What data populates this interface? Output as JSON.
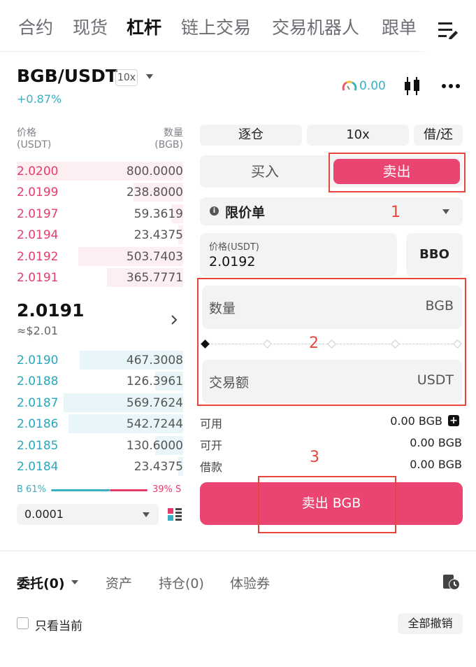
{
  "top_tabs": [
    {
      "label": "合约"
    },
    {
      "label": "现货"
    },
    {
      "label": "杠杆"
    },
    {
      "label": "链上交易"
    },
    {
      "label": "交易机器人"
    },
    {
      "label": "跟单"
    }
  ],
  "active_tab": "杠杆",
  "header": {
    "pair": "BGB/USDT",
    "leverage_badge": "10x",
    "change": "+0.87%",
    "gauge_value": "0.00"
  },
  "orderbook": {
    "price_label": "价格",
    "price_unit": "(USDT)",
    "qty_label": "数量",
    "qty_unit": "(BGB)",
    "asks": [
      {
        "price": "2.0200",
        "qty": "800.0000",
        "depth": 1.0
      },
      {
        "price": "2.0199",
        "qty": "238.8000",
        "depth": 0.3
      },
      {
        "price": "2.0197",
        "qty": "59.3619",
        "depth": 0.07
      },
      {
        "price": "2.0194",
        "qty": "23.4375",
        "depth": 0.03
      },
      {
        "price": "2.0192",
        "qty": "503.7403",
        "depth": 0.63
      },
      {
        "price": "2.0191",
        "qty": "365.7771",
        "depth": 0.46
      }
    ],
    "mid_price": "2.0191",
    "mid_usd": "≈$2.01",
    "bids": [
      {
        "price": "2.0190",
        "qty": "467.3008",
        "depth": 0.62
      },
      {
        "price": "2.0188",
        "qty": "126.3961",
        "depth": 0.17
      },
      {
        "price": "2.0187",
        "qty": "569.7624",
        "depth": 0.72
      },
      {
        "price": "2.0186",
        "qty": "542.7244",
        "depth": 0.69
      },
      {
        "price": "2.0185",
        "qty": "130.6000",
        "depth": 0.17
      },
      {
        "price": "2.0184",
        "qty": "23.4375",
        "depth": 0.03
      }
    ],
    "buy_ratio_label": "B 61%",
    "sell_ratio_label": "39% S",
    "buy_ratio": 0.61,
    "precision": "0.0001"
  },
  "form": {
    "margin_mode": "逐仓",
    "leverage": "10x",
    "borrow_repay": "借/还",
    "buy_label": "买入",
    "sell_label": "卖出",
    "order_type": "限价单",
    "order_info_icon": "i",
    "price_label": "价格(USDT)",
    "price_value": "2.0192",
    "bbo_label": "BBO",
    "amount_placeholder": "数量",
    "amount_unit": "BGB",
    "total_placeholder": "交易额",
    "total_unit": "USDT",
    "slider_value": 0,
    "available_label": "可用",
    "available_value": "0.00 BGB",
    "openable_label": "可开",
    "openable_value": "0.00 BGB",
    "borrow_label": "借款",
    "borrow_value": "0.00 BGB",
    "submit_label": "卖出 BGB"
  },
  "annotations": [
    "1",
    "2",
    "3"
  ],
  "bottom": {
    "tabs": [
      {
        "label": "委托(0)"
      },
      {
        "label": "资产"
      },
      {
        "label": "持仓(0)"
      },
      {
        "label": "体验券"
      }
    ],
    "only_current_label": "只看当前",
    "cancel_all_label": "全部撤销"
  },
  "colors": {
    "sell": "#ea4471",
    "buy": "#39b0c2",
    "annotation": "#e7463d"
  }
}
